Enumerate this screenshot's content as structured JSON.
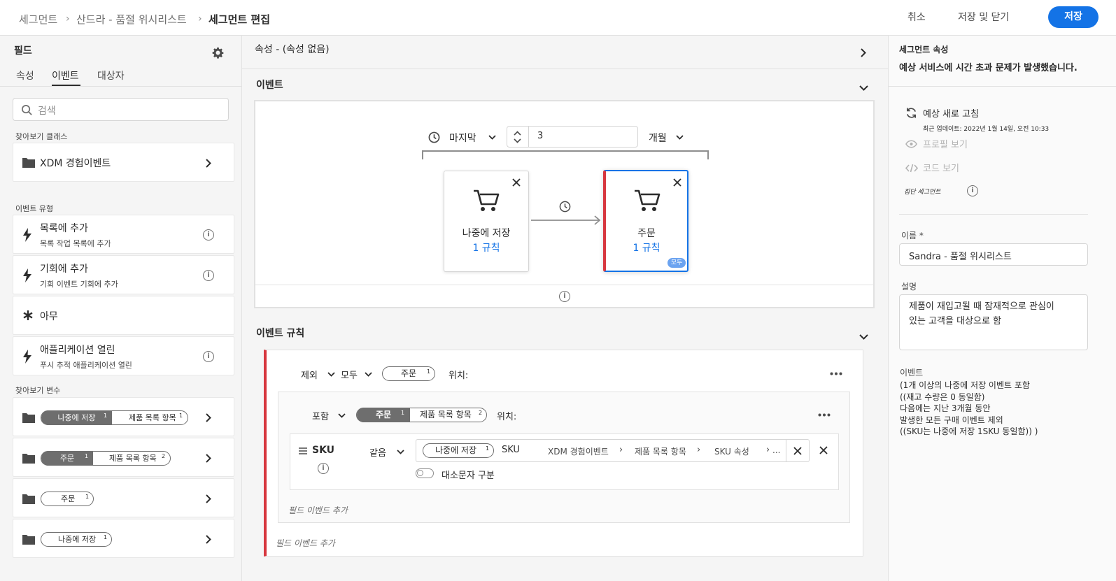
{
  "breadcrumb": {
    "item1": "세그먼트",
    "item2": "산드라 - 품절 위시리스트",
    "current": "세그먼트 편집"
  },
  "toolbar": {
    "cancel": "취소",
    "save_close": "저장 및 닫기",
    "save": "저장"
  },
  "left": {
    "title": "필드",
    "tabs": [
      "속성",
      "이벤트",
      "대상자"
    ],
    "active_tab": "이벤트",
    "search_placeholder": "검색",
    "browse_class_label": "찾아보기 클래스",
    "class_item": "XDM 경험이벤트",
    "event_types_label": "이벤트 유형",
    "event_types": [
      {
        "title": "목록에 추가",
        "sub": "목록 작업 목록에 추가"
      },
      {
        "title": "기회에 추가",
        "sub": "기회 이벤트 기회에 추가"
      },
      {
        "title": "아무",
        "sub": ""
      },
      {
        "title": "애플리케이션 열린",
        "sub": "푸시 추적 애플리케이션 열린"
      }
    ],
    "browse_vars_label": "찾아보기 변수",
    "vars": [
      {
        "a": "나중에 저장",
        "a_n": "1",
        "b": "제품 목록 항목",
        "b_n": "1"
      },
      {
        "a": "주문",
        "a_n": "1",
        "b": "제품 목록 항목",
        "b_n": "2"
      },
      {
        "a": "주문",
        "a_n": "1"
      },
      {
        "a": "나중에 저장",
        "a_n": "1"
      }
    ]
  },
  "center": {
    "attributes_header": "속성 - (속성 없음)",
    "events_header": "이벤트",
    "timeframe": {
      "type": "마지막",
      "value": "3",
      "unit": "개월"
    },
    "node1": {
      "title": "나중에 저장",
      "rule": "1 규칙"
    },
    "node2": {
      "title": "주문",
      "rule": "1 규칙",
      "badge": "모두"
    },
    "event_rules_header": "이벤트 규칙",
    "outer_rule": {
      "mode": "제외",
      "scope": "모두",
      "chip": "주문",
      "chip_n": "1",
      "where": "위치:"
    },
    "inner_rule": {
      "mode": "포함",
      "chip_a": "주문",
      "chip_a_n": "1",
      "chip_b": "제품 목록 항목",
      "chip_b_n": "2",
      "where": "위치:"
    },
    "condition": {
      "field": "SKU",
      "operator": "같음",
      "value_chip": "나중에 저장",
      "value_chip_n": "1",
      "value_field": "SKU",
      "path": [
        "XDM 경험이벤트",
        "제품 목록 항목",
        "SKU 속성",
        "..."
      ],
      "case_label": "대소문자 구분"
    },
    "add_field_event_inner": "필드 이벤드 추가",
    "add_field_event_outer": "필드 이벤드 추가"
  },
  "right": {
    "title": "세그먼트 속성",
    "error": "예상 서비스에 시간 초과 문제가 발생했습니다.",
    "refresh": "예상 새로 고침",
    "last_update": "최근 업데이트: 2022년 1월 14일, 오전 10:33",
    "view_profiles": "프로필 보기",
    "view_code": "코드 보기",
    "collective": "집단 세그먼트",
    "name_label": "이름 *",
    "name_value": "Sandra - 품절 위시리스트",
    "desc_label": "설명",
    "desc_value": "제품이 재입고될 때 잠재적으로 관심이 있는 고객을 대상으로 함",
    "events_label": "이벤트",
    "events_lines": [
      "(1개 이상의 나중에 저장 이벤트 포함",
      "((재고 수량은 0 동일함)",
      "다음에는 지난 3개월 동안",
      "발생한 모든 구매 이벤트 제외",
      "((SKU는 나중에 저장 1SKU 동일함)) )"
    ]
  },
  "colors": {
    "accent": "#1473e6",
    "exclude_bar": "#d7373f"
  }
}
